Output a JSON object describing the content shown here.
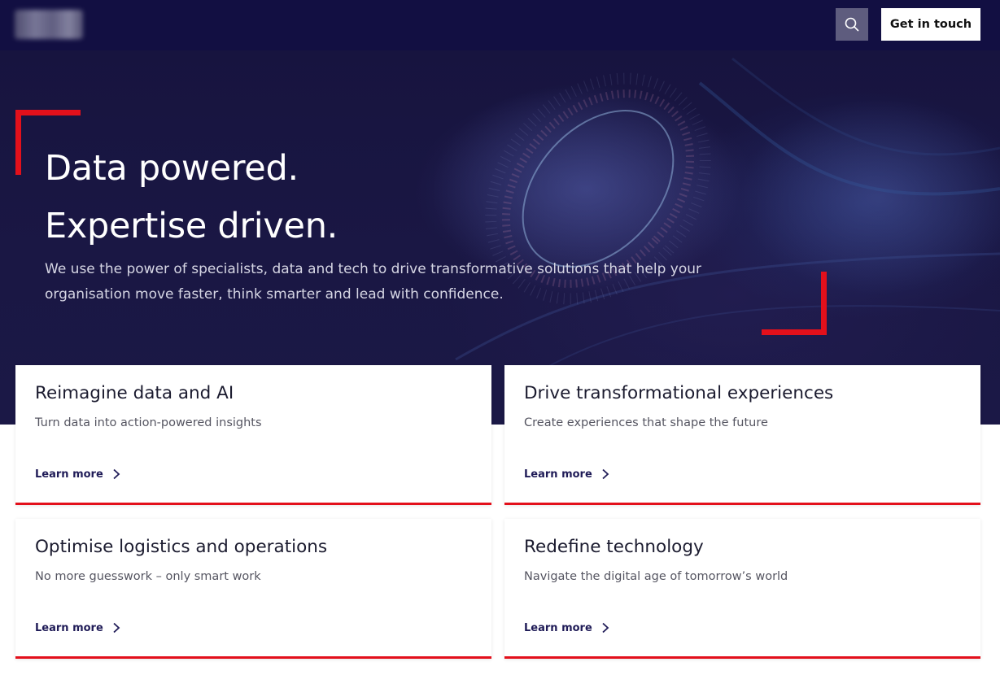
{
  "header": {
    "search_icon": "search-icon",
    "cta_label": "Get in touch"
  },
  "hero": {
    "title_line1": "Data powered.",
    "title_line2": "Expertise driven.",
    "subtitle": "We use the power of specialists, data and tech to drive transformative solutions that help your organisation move faster, think smarter and lead with confidence."
  },
  "cards": [
    {
      "title": "Reimagine data and AI",
      "description": "Turn data into action-powered insights",
      "link": "Learn more"
    },
    {
      "title": "Drive transformational experiences",
      "description": "Create experiences that shape the future",
      "link": "Learn more"
    },
    {
      "title": "Optimise logistics and operations",
      "description": "No more guesswork – only smart work",
      "link": "Learn more"
    },
    {
      "title": "Redefine technology",
      "description": "Navigate the digital age of tomorrow’s world",
      "link": "Learn more"
    }
  ],
  "colors": {
    "header_bg": "#120f42",
    "accent_red": "#e3101b",
    "link_navy": "#1f1b57"
  }
}
